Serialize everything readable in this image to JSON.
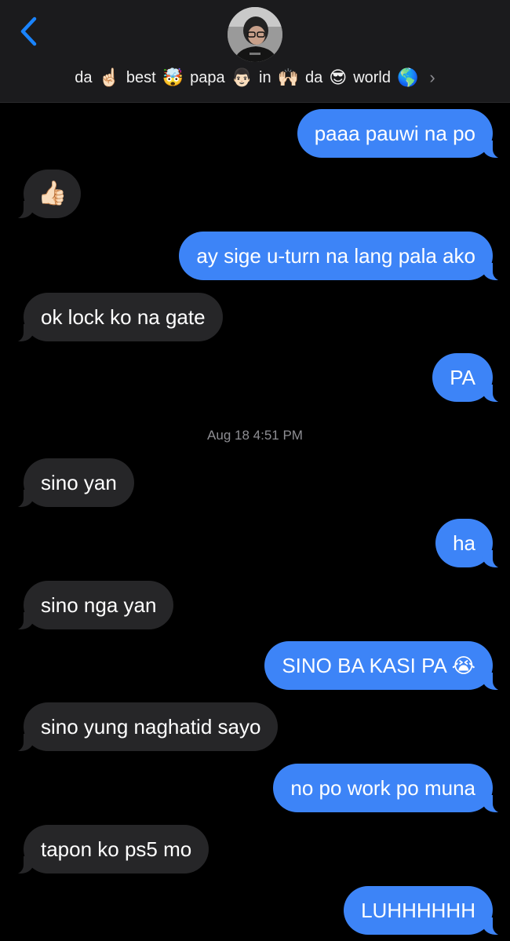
{
  "header": {
    "contact_name_parts": [
      "da",
      "☝🏻",
      "best",
      "🤯",
      "papa",
      "👨🏻",
      "in",
      "🙌🏻",
      "da",
      "😎",
      "world",
      "🌎"
    ],
    "chevron": "›",
    "back_icon": "chevron-left-icon"
  },
  "timestamp": "Aug 18 4:51 PM",
  "messages": [
    {
      "from": "me",
      "text": "paaa pauwi na po"
    },
    {
      "from": "them",
      "text": "👍🏻"
    },
    {
      "from": "me",
      "text": "ay sige u-turn na lang pala ako"
    },
    {
      "from": "them",
      "text": "ok lock ko na gate"
    },
    {
      "from": "me",
      "text": "PA"
    },
    {
      "from": "them",
      "text": "sino yan"
    },
    {
      "from": "me",
      "text": "ha"
    },
    {
      "from": "them",
      "text": "sino nga yan"
    },
    {
      "from": "me",
      "text": "SINO BA KASI PA 😭"
    },
    {
      "from": "them",
      "text": "sino yung naghatid sayo"
    },
    {
      "from": "me",
      "text": "no po work po muna"
    },
    {
      "from": "them",
      "text": "tapon ko ps5 mo"
    },
    {
      "from": "me",
      "text": "LUHHHHHH"
    }
  ],
  "colors": {
    "sent_bubble": "#3d84f7",
    "received_bubble": "#262628",
    "background": "#000000",
    "header_bg": "#1b1b1d",
    "accent": "#1a84ff"
  }
}
